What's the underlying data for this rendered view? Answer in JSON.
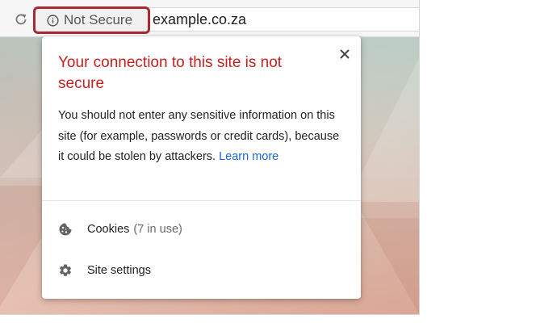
{
  "toolbar": {
    "security_label": "Not Secure",
    "url": "example.co.za",
    "reload_icon": "reload-icon",
    "info_icon": "info-icon",
    "chip_highlight_color": "#a52a34"
  },
  "popup": {
    "title": "Your connection to this site is not secure",
    "body_text": "You should not enter any sensitive information on this site (for example, passwords or credit cards), because it could be stolen by attackers.",
    "learn_more": "Learn more",
    "close_icon": "close-icon",
    "title_color": "#c5221f",
    "link_color": "#1a66d2",
    "rows": [
      {
        "icon": "cookie-icon",
        "label": "Cookies",
        "sub": "(7 in use)"
      },
      {
        "icon": "gear-icon",
        "label": "Site settings",
        "sub": ""
      }
    ]
  }
}
